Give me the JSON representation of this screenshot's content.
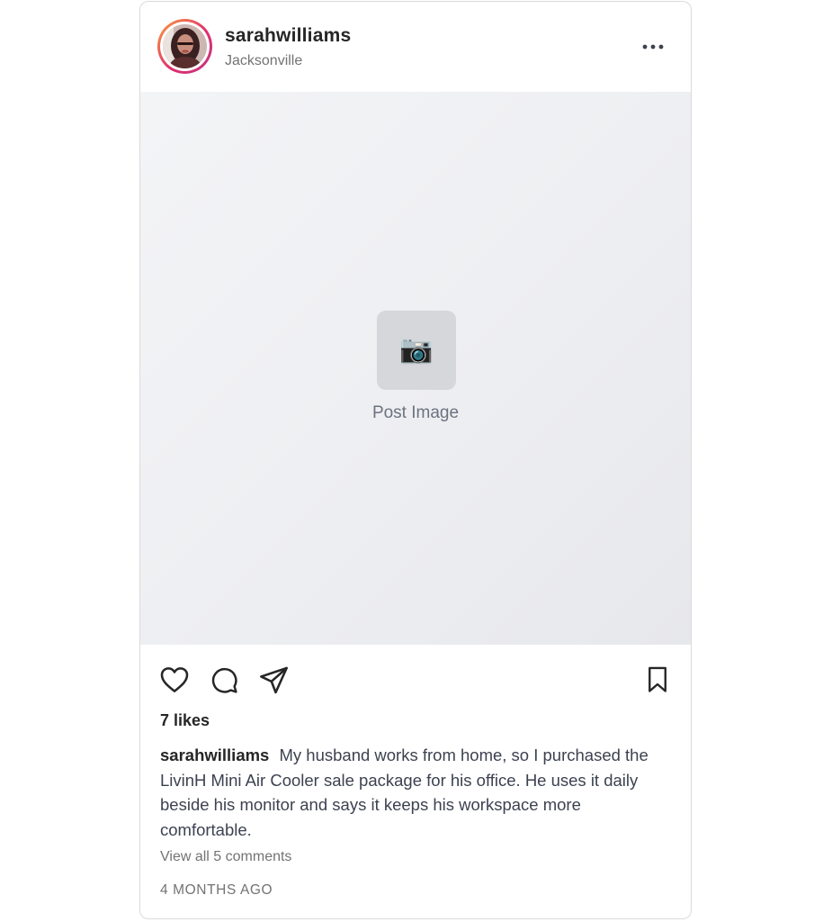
{
  "post": {
    "username": "sarahwilliams",
    "location": "Jacksonville",
    "image_placeholder_label": "Post Image",
    "image_placeholder_icon": "📷",
    "likes_text": "7 likes",
    "caption_username": "sarahwilliams",
    "caption_text": "My husband works from home, so I purchased the LivinH Mini Air Cooler sale package for his office. He uses it daily beside his monitor and says it keeps his workspace more comfortable.",
    "view_comments_text": "View all 5 comments",
    "timestamp": "4 MONTHS AGO"
  },
  "icons": {
    "more": "more-horizontal-icon",
    "like": "heart-icon",
    "comment": "comment-icon",
    "share": "paper-plane-icon",
    "save": "bookmark-icon"
  },
  "colors": {
    "text_primary": "#262626",
    "text_secondary": "#737373",
    "card_border": "#dbdbdb",
    "image_background": "#eeeff2",
    "avatar_ring_start": "#f9a23a",
    "avatar_ring_end": "#c13584"
  }
}
